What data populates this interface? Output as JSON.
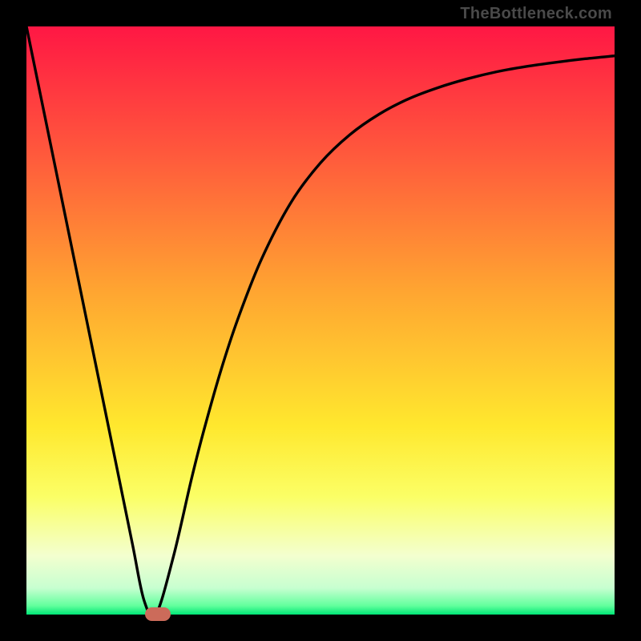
{
  "attribution": "TheBottleneck.com",
  "chart_data": {
    "type": "line",
    "title": "",
    "xlabel": "",
    "ylabel": "",
    "xlim": [
      0,
      100
    ],
    "ylim": [
      0,
      100
    ],
    "background_gradient": {
      "stops": [
        {
          "offset": 0.0,
          "color": "#ff1744"
        },
        {
          "offset": 0.22,
          "color": "#ff5a3c"
        },
        {
          "offset": 0.45,
          "color": "#ffa531"
        },
        {
          "offset": 0.68,
          "color": "#ffe82e"
        },
        {
          "offset": 0.8,
          "color": "#fbff66"
        },
        {
          "offset": 0.9,
          "color": "#f3ffcf"
        },
        {
          "offset": 0.955,
          "color": "#c7ffd0"
        },
        {
          "offset": 0.985,
          "color": "#62ff9d"
        },
        {
          "offset": 1.0,
          "color": "#00e676"
        }
      ]
    },
    "series": [
      {
        "name": "bottleneck-curve",
        "x": [
          0,
          5,
          10,
          15,
          18,
          20,
          22,
          25,
          28,
          30,
          33,
          36,
          40,
          45,
          50,
          55,
          60,
          65,
          70,
          75,
          80,
          85,
          90,
          95,
          100
        ],
        "y": [
          100,
          75.6,
          51.2,
          26.8,
          12.1,
          2.4,
          0,
          9.9,
          22.8,
          30.7,
          41.3,
          50.4,
          60.5,
          70.1,
          76.8,
          81.6,
          85.1,
          87.7,
          89.6,
          91.1,
          92.3,
          93.2,
          93.9,
          94.5,
          95.0
        ]
      }
    ],
    "marker": {
      "name": "optimal-range",
      "x_start": 20.1,
      "x_end": 24.5,
      "y": 0,
      "color": "#cc6b5a",
      "thickness_px": 17
    }
  }
}
